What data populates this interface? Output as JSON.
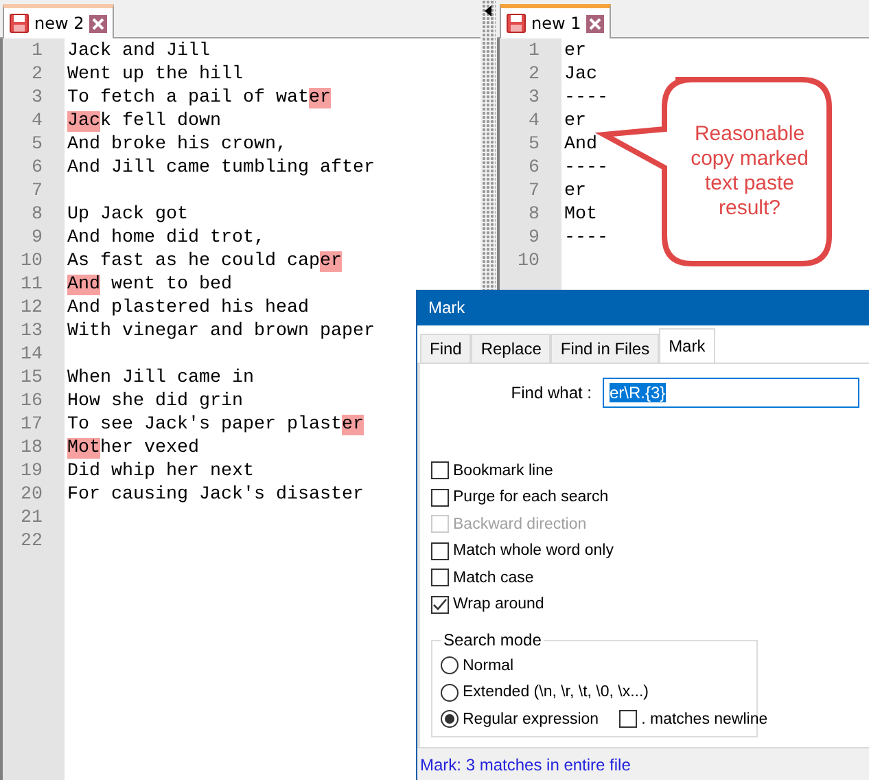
{
  "editors": [
    {
      "tab": {
        "title": "new 2",
        "selected": false
      },
      "lines": [
        {
          "number": "1",
          "segments": [
            {
              "text": "Jack and Jill",
              "marked": false
            }
          ]
        },
        {
          "number": "2",
          "segments": [
            {
              "text": "Went up the hill",
              "marked": false
            }
          ]
        },
        {
          "number": "3",
          "segments": [
            {
              "text": "To fetch a pail of wat",
              "marked": false
            },
            {
              "text": "er",
              "marked": true
            }
          ]
        },
        {
          "number": "4",
          "segments": [
            {
              "text": "Jac",
              "marked": true
            },
            {
              "text": "k fell down",
              "marked": false
            }
          ]
        },
        {
          "number": "5",
          "segments": [
            {
              "text": "And broke his crown,",
              "marked": false
            }
          ]
        },
        {
          "number": "6",
          "segments": [
            {
              "text": "And Jill came tumbling after",
              "marked": false
            }
          ]
        },
        {
          "number": "7"
        },
        {
          "number": "8",
          "segments": [
            {
              "text": "Up Jack got",
              "marked": false
            }
          ]
        },
        {
          "number": "9",
          "segments": [
            {
              "text": "And home did trot,",
              "marked": false
            }
          ]
        },
        {
          "number": "10",
          "segments": [
            {
              "text": "As fast as he could cap",
              "marked": false
            },
            {
              "text": "er",
              "marked": true
            }
          ]
        },
        {
          "number": "11",
          "segments": [
            {
              "text": "And",
              "marked": true
            },
            {
              "text": " went to bed",
              "marked": false
            }
          ]
        },
        {
          "number": "12",
          "segments": [
            {
              "text": "And plastered his head",
              "marked": false
            }
          ]
        },
        {
          "number": "13",
          "segments": [
            {
              "text": "With vinegar and brown paper",
              "marked": false
            }
          ]
        },
        {
          "number": "14"
        },
        {
          "number": "15",
          "segments": [
            {
              "text": "When Jill came in",
              "marked": false
            }
          ]
        },
        {
          "number": "16",
          "segments": [
            {
              "text": "How she did grin",
              "marked": false
            }
          ]
        },
        {
          "number": "17",
          "segments": [
            {
              "text": "To see Jack's paper plast",
              "marked": false
            },
            {
              "text": "er",
              "marked": true
            }
          ]
        },
        {
          "number": "18",
          "segments": [
            {
              "text": "Mot",
              "marked": true
            },
            {
              "text": "her vexed",
              "marked": false
            }
          ]
        },
        {
          "number": "19",
          "segments": [
            {
              "text": "Did whip her next",
              "marked": false
            }
          ]
        },
        {
          "number": "20",
          "segments": [
            {
              "text": "For causing Jack's disaster",
              "marked": false
            }
          ]
        },
        {
          "number": "21"
        },
        {
          "number": "22"
        }
      ]
    },
    {
      "tab": {
        "title": "new 1",
        "selected": true
      },
      "lines": [
        {
          "number": "1",
          "segments": [
            {
              "text": "er",
              "marked": false
            }
          ]
        },
        {
          "number": "2",
          "segments": [
            {
              "text": "Jac",
              "marked": false
            }
          ]
        },
        {
          "number": "3",
          "segments": [
            {
              "text": "----",
              "marked": false
            }
          ]
        },
        {
          "number": "4",
          "segments": [
            {
              "text": "er",
              "marked": false
            }
          ]
        },
        {
          "number": "5",
          "segments": [
            {
              "text": "And",
              "marked": false
            }
          ]
        },
        {
          "number": "6",
          "segments": [
            {
              "text": "----",
              "marked": false
            }
          ]
        },
        {
          "number": "7",
          "segments": [
            {
              "text": "er",
              "marked": false
            }
          ]
        },
        {
          "number": "8",
          "segments": [
            {
              "text": "Mot",
              "marked": false
            }
          ]
        },
        {
          "number": "9",
          "segments": [
            {
              "text": "----",
              "marked": false
            }
          ]
        },
        {
          "number": "10"
        }
      ]
    }
  ],
  "callout": {
    "text": "Reasonable copy marked text paste result?"
  },
  "dialog": {
    "title": "Mark",
    "tabs": [
      {
        "label": "Find",
        "selected": false
      },
      {
        "label": "Replace",
        "selected": false
      },
      {
        "label": "Find in Files",
        "selected": false
      },
      {
        "label": "Mark",
        "selected": true
      }
    ],
    "find_label": "Find what :",
    "find_value": "er\\R.{3}",
    "options": [
      {
        "label": "Bookmark line",
        "checked": false,
        "disabled": false
      },
      {
        "label": "Purge for each search",
        "checked": false,
        "disabled": false
      },
      {
        "label": "Backward direction",
        "checked": false,
        "disabled": true
      },
      {
        "label": "Match whole word only",
        "checked": false,
        "disabled": false
      },
      {
        "label": "Match case",
        "checked": false,
        "disabled": false
      },
      {
        "label": "Wrap around",
        "checked": true,
        "disabled": false
      }
    ],
    "search_mode": {
      "title": "Search mode",
      "modes": [
        {
          "label": "Normal",
          "selected": false
        },
        {
          "label": "Extended (\\n, \\r, \\t, \\0, \\x...)",
          "selected": false
        },
        {
          "label": "Regular expression",
          "selected": true
        }
      ],
      "dot_newline": {
        "label": ". matches newline",
        "checked": false
      }
    },
    "status": "Mark: 3 matches in entire file"
  }
}
